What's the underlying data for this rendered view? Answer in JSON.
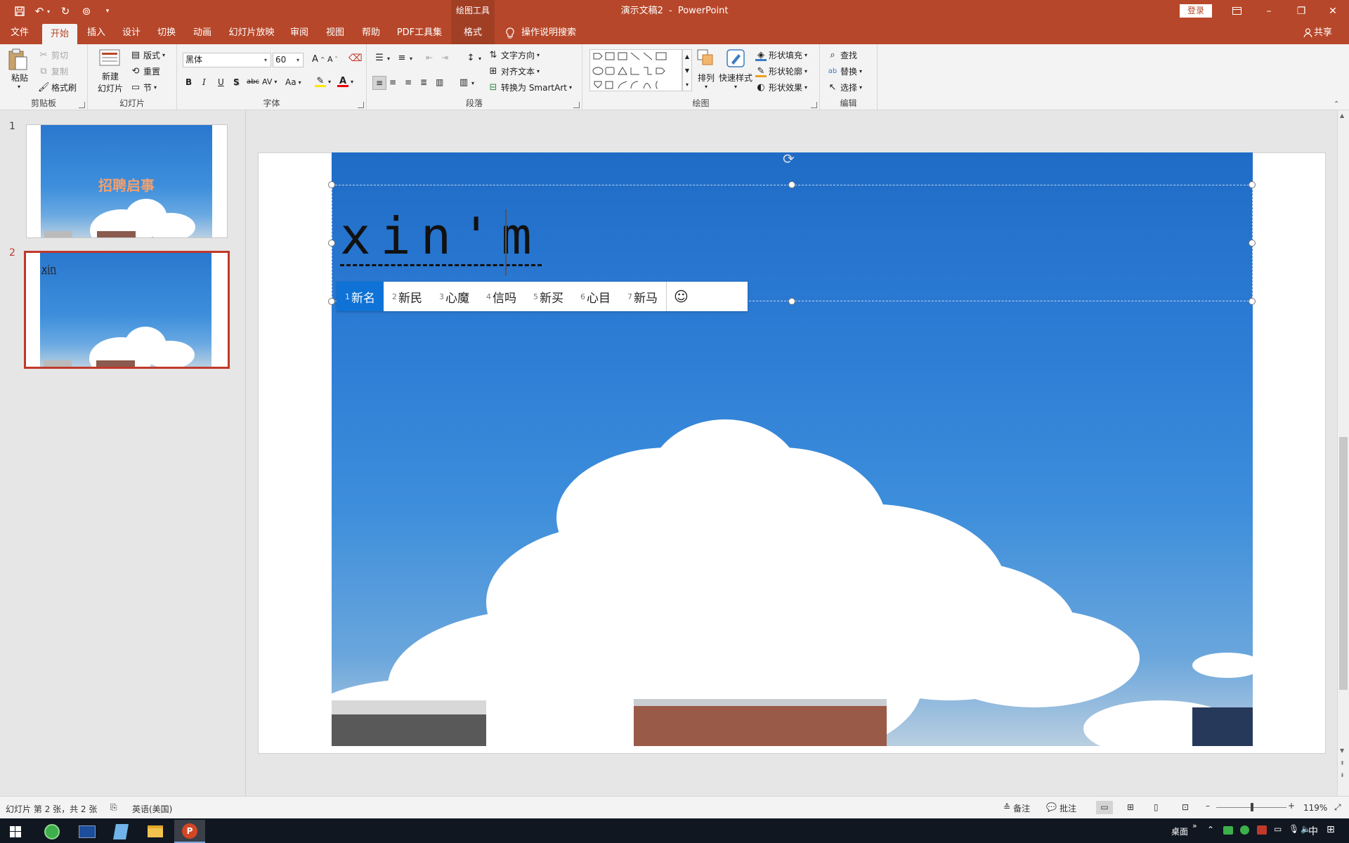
{
  "titlebar": {
    "context_tools": "绘图工具",
    "doc_name": "演示文稿2",
    "separator": "-",
    "app_name": "PowerPoint",
    "login": "登录"
  },
  "tabs": {
    "file": "文件",
    "home": "开始",
    "insert": "插入",
    "design": "设计",
    "transitions": "切换",
    "animations": "动画",
    "slideshow": "幻灯片放映",
    "review": "审阅",
    "view": "视图",
    "help": "帮助",
    "pdf": "PDF工具集",
    "format": "格式",
    "tellme": "操作说明搜索",
    "share": "共享"
  },
  "ribbon": {
    "clipboard": {
      "label": "剪贴板",
      "paste": "粘贴",
      "cut": "剪切",
      "copy": "复制",
      "painter": "格式刷"
    },
    "slides": {
      "label": "幻灯片",
      "new_slide_1": "新建",
      "new_slide_2": "幻灯片",
      "layout": "版式",
      "reset": "重置",
      "section": "节"
    },
    "font": {
      "label": "字体",
      "font_name": "黑体",
      "font_size": "60",
      "bold": "B",
      "italic": "I",
      "underline": "U",
      "shadow": "S",
      "strike": "abc",
      "spacing": "AV",
      "case": "Aa",
      "grow": "A",
      "shrink": "A"
    },
    "paragraph": {
      "label": "段落",
      "text_direction": "文字方向",
      "align_text": "对齐文本",
      "smartart": "转换为 SmartArt"
    },
    "drawing": {
      "label": "绘图",
      "arrange": "排列",
      "quick_styles": "快速样式",
      "fill": "形状填充",
      "outline": "形状轮廓",
      "effects": "形状效果"
    },
    "editing": {
      "label": "编辑",
      "find": "查找",
      "replace": "替换",
      "select": "选择"
    }
  },
  "thumbnails": [
    {
      "number": "1",
      "title": "招聘启事"
    },
    {
      "number": "2",
      "title": "xin"
    }
  ],
  "slide": {
    "typed_text": "xin'm"
  },
  "ime": {
    "candidates": [
      {
        "index": "1",
        "text": "新名"
      },
      {
        "index": "2",
        "text": "新民"
      },
      {
        "index": "3",
        "text": "心魔"
      },
      {
        "index": "4",
        "text": "信吗"
      },
      {
        "index": "5",
        "text": "新买"
      },
      {
        "index": "6",
        "text": "心目"
      },
      {
        "index": "7",
        "text": "新马"
      }
    ],
    "emoji": "☺"
  },
  "statusbar": {
    "slide_info": "幻灯片 第 2 张，共 2 张",
    "language": "英语(美国)",
    "notes": "备注",
    "comments": "批注",
    "zoom": "119%"
  },
  "taskbar": {
    "desktop": "桌面",
    "ime_mode": "中"
  },
  "colors": {
    "brand": "#b7472a",
    "ime_selected": "#0f72d6",
    "thumb_title": "#f0a070"
  }
}
